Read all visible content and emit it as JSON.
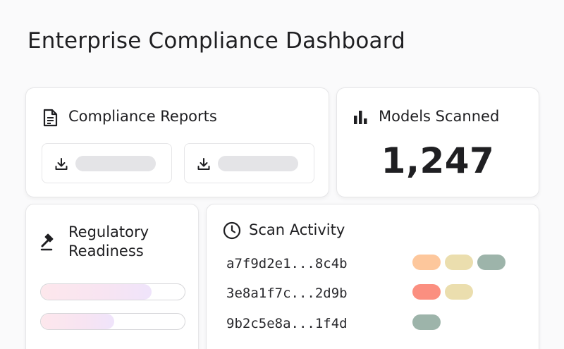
{
  "page": {
    "title": "Enterprise Compliance Dashboard"
  },
  "reports": {
    "title": "Compliance Reports",
    "icon": "document-icon",
    "buttons": [
      {
        "icon": "download-icon"
      },
      {
        "icon": "download-icon"
      }
    ]
  },
  "models": {
    "title": "Models Scanned",
    "icon": "bar-chart-icon",
    "count": "1,247"
  },
  "readiness": {
    "title": "Regulatory Readiness",
    "icon": "gavel-icon",
    "bars": [
      {
        "level": 0.77
      },
      {
        "level": 0.51
      }
    ]
  },
  "activity": {
    "title": "Scan Activity",
    "icon": "clock-icon",
    "rows": [
      {
        "hash": "a7f9d2e1...8c4b",
        "tags": [
          "#fdc79c",
          "#ebdeae",
          "#9db4aa"
        ]
      },
      {
        "hash": "3e8a1f7c...2d9b",
        "tags": [
          "#fb8f80",
          "#ebdeae"
        ]
      },
      {
        "hash": "9b2c5e8a...1f4d",
        "tags": [
          "#9db4aa"
        ]
      }
    ]
  }
}
